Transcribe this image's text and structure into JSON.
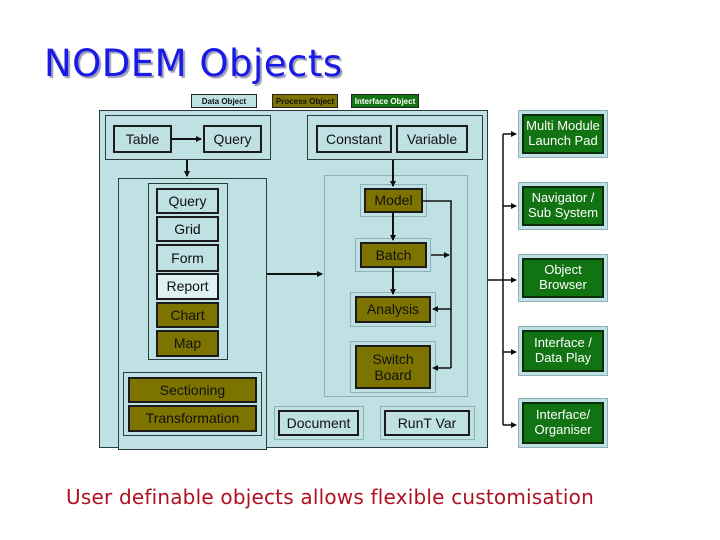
{
  "title": "NODEM Objects",
  "legend": [
    {
      "label": "Data Object",
      "color": "#bfe1e4"
    },
    {
      "label": "Process Object",
      "color": "#7d7400"
    },
    {
      "label": "Interface Object",
      "color": "#127312"
    }
  ],
  "data_sources": {
    "table": "Table",
    "query": "Query",
    "constant": "Constant",
    "variable": "Variable"
  },
  "data_objects": [
    "Query",
    "Grid",
    "Form",
    "Report",
    "Chart",
    "Map"
  ],
  "data_process": [
    "Sectioning",
    "Transformation"
  ],
  "process_chain": [
    "Model",
    "Batch",
    "Analysis",
    "Switch Board"
  ],
  "bottom_objects": [
    "Document",
    "RunT Var"
  ],
  "interface_objects": [
    "Multi Module Launch Pad",
    "Navigator / Sub System",
    "Object Browser",
    "Interface / Data Play",
    "Interface/ Organiser"
  ],
  "interface_lines": [
    [
      "Multi Module",
      "Launch Pad"
    ],
    [
      "Navigator /",
      "Sub System"
    ],
    [
      "Object",
      "Browser"
    ],
    [
      "Interface /",
      "Data Play"
    ],
    [
      "Interface/",
      "Organiser"
    ]
  ],
  "switch_board_lines": [
    "Switch",
    "Board"
  ],
  "footer": "User definable objects allows flexible customisation"
}
